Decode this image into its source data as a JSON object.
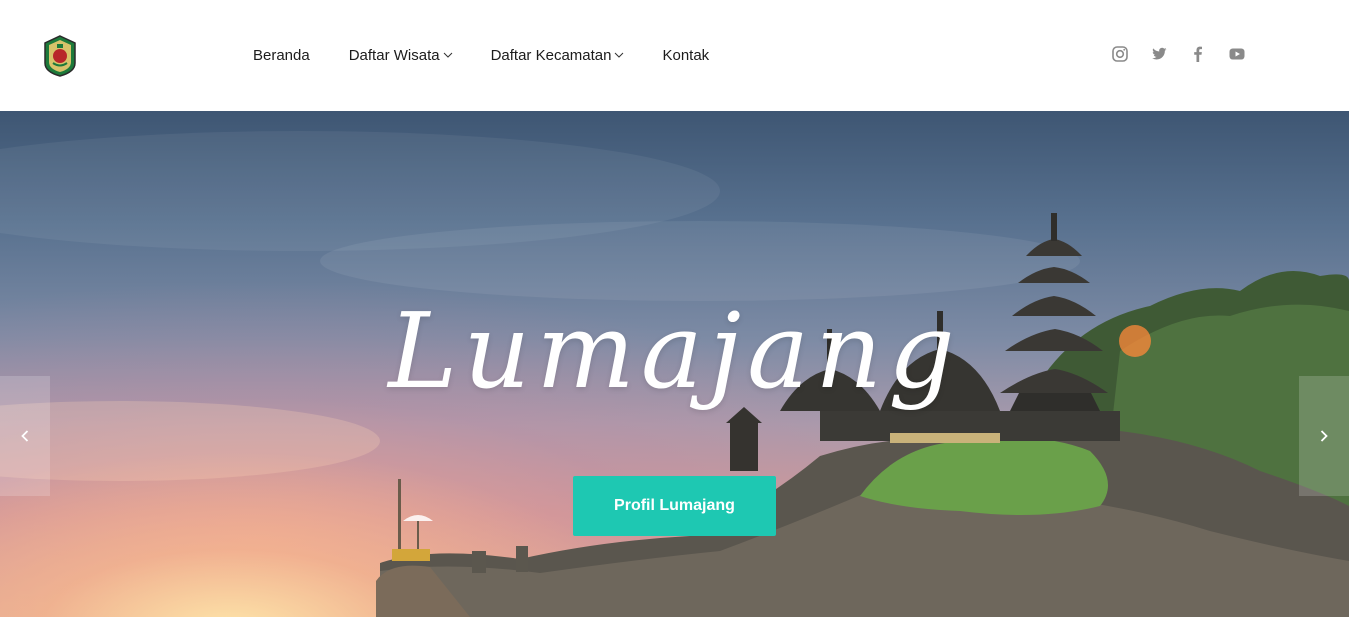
{
  "header": {
    "logo_icon": "crest-logo-icon",
    "nav": {
      "beranda": "Beranda",
      "daftar_wisata": "Daftar Wisata",
      "daftar_kecamatan": "Daftar Kecamatan",
      "kontak": "Kontak"
    },
    "social_icons": [
      "instagram-icon",
      "twitter-icon",
      "facebook-icon",
      "youtube-icon"
    ]
  },
  "hero": {
    "title": "Lumajang",
    "button_label": "Profil Lumajang",
    "prev_icon": "chevron-left-icon",
    "next_icon": "chevron-right-icon",
    "accent_color": "#1ec8b2"
  }
}
